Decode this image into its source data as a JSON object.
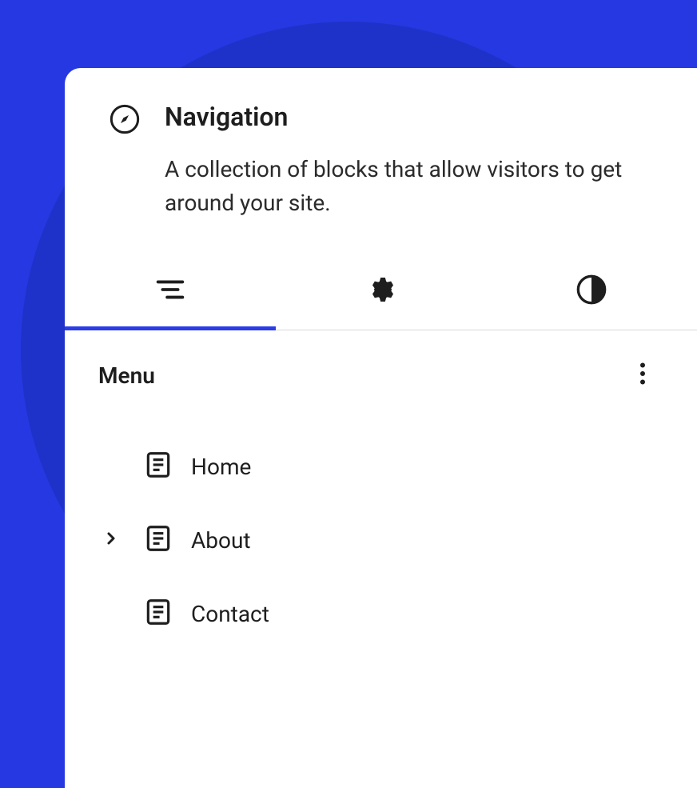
{
  "block": {
    "title": "Navigation",
    "description": "A collection of blocks that allow visitors to get around your site."
  },
  "menu": {
    "heading": "Menu",
    "items": [
      {
        "label": "Home",
        "expandable": false
      },
      {
        "label": "About",
        "expandable": true
      },
      {
        "label": "Contact",
        "expandable": false
      }
    ]
  },
  "tabs": {
    "active_index": 0
  }
}
